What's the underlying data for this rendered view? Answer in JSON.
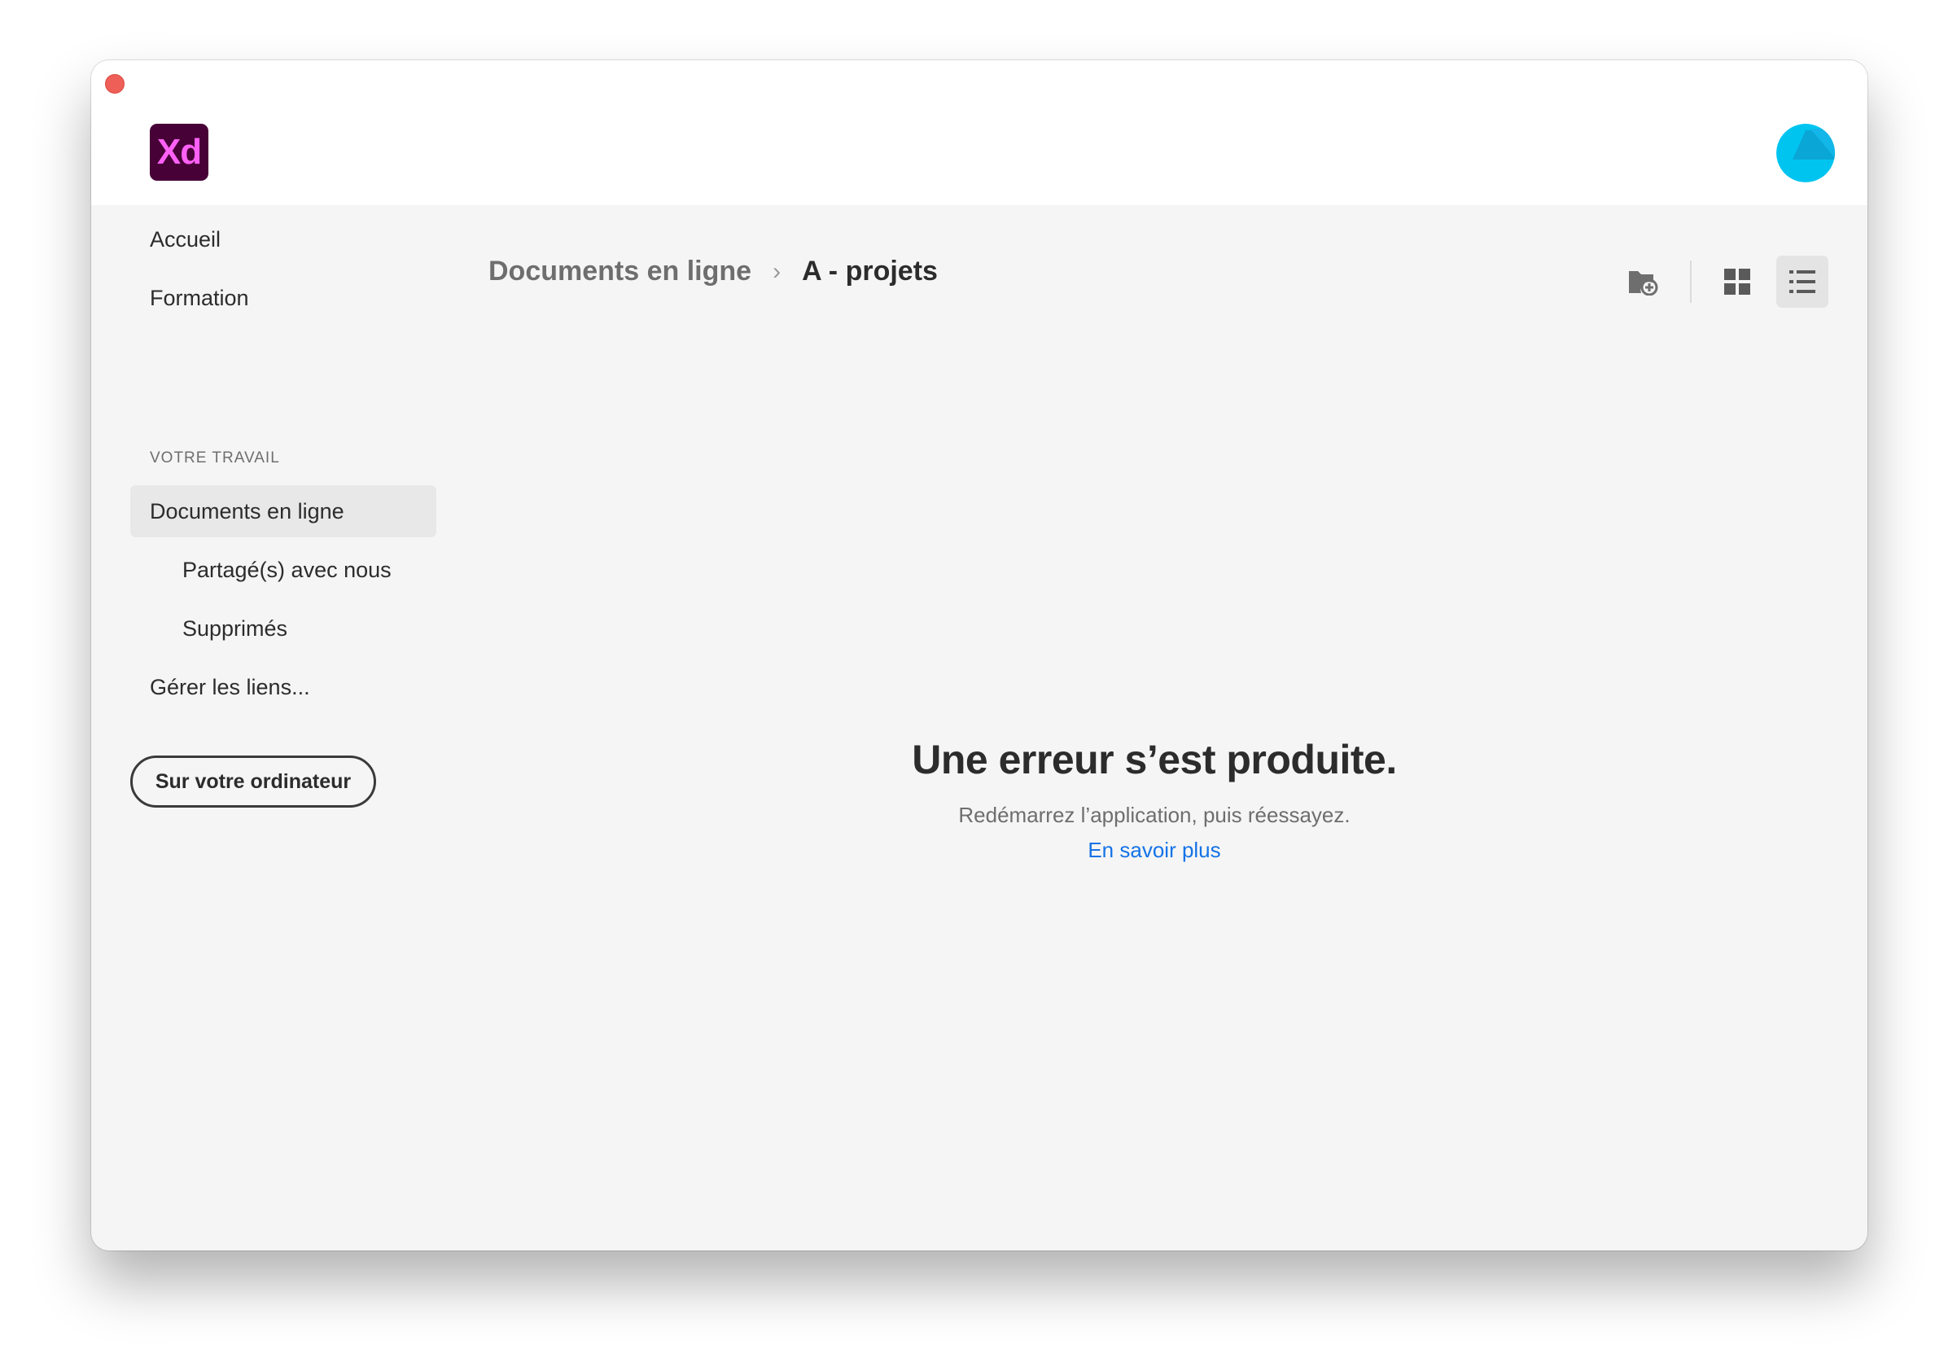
{
  "app": {
    "logo_text": "Xd",
    "colors": {
      "logo_bg": "#470137",
      "logo_fg": "#ff61f6",
      "link": "#1473e6",
      "avatar": "#00c4f0"
    }
  },
  "sidebar": {
    "items": [
      {
        "label": "Accueil"
      },
      {
        "label": "Formation"
      },
      {
        "label": "Documents en ligne",
        "selected": true
      },
      {
        "label": "Partagé(s) avec nous"
      },
      {
        "label": "Supprimés"
      },
      {
        "label": "Gérer les liens..."
      }
    ],
    "section_label": "VOTRE TRAVAIL",
    "local_button_label": "Sur votre ordinateur"
  },
  "breadcrumb": {
    "parent": "Documents en ligne",
    "separator": "›",
    "current": "A - projets"
  },
  "toolbar": {
    "icons": [
      "new-folder-icon",
      "grid-view-icon",
      "list-view-icon"
    ],
    "active_view": "list"
  },
  "error": {
    "title": "Une erreur s’est produite.",
    "message": "Redémarrez l’application, puis réessayez.",
    "link": "En savoir plus"
  }
}
